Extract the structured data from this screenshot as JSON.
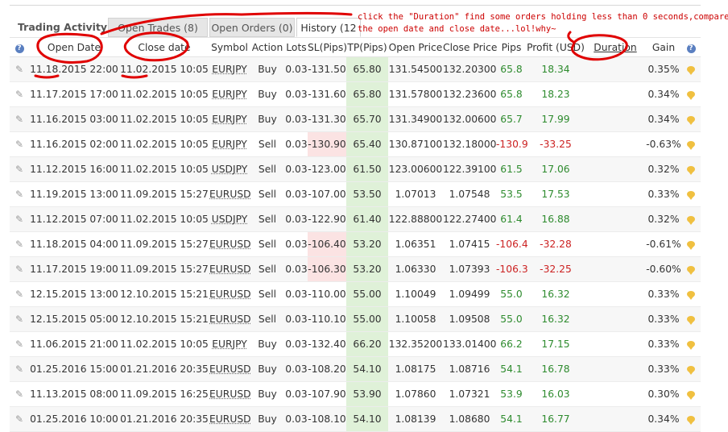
{
  "tabs": {
    "title": "Trading Activity",
    "open_trades": "Open Trades (8)",
    "open_orders": "Open Orders (0)",
    "history": "History (12"
  },
  "annotation": "click the \"Duration\" find some orders holding less than 0 seconds,compare\nthe open date and close date...lol!why~",
  "headers": [
    "Open Date",
    "Close date",
    "Symbol",
    "Action",
    "Lots",
    "SL(Pips)",
    "TP(Pips)",
    "Open Price",
    "Close Price",
    "Pips",
    "Profit (USD)",
    "Duration",
    "Gain"
  ],
  "colors": {
    "positive": "#2e8b2e",
    "negative": "#cc2222",
    "tp_fill": "#dff1d8",
    "sl_fill": "#fbe3e3",
    "annotation": "#cc0000"
  },
  "rows": [
    {
      "open": "11.18.2015 22:00",
      "close": "11.02.2015 10:05",
      "symbol": "EURJPY",
      "action": "Buy",
      "lots": "0.03",
      "sl": "-131.50",
      "tp": "65.80",
      "open_price": "131.54500",
      "close_price": "132.20300",
      "pips": "65.8",
      "profit": "18.34",
      "gain": "0.35%",
      "neg": false,
      "sl_bad": false
    },
    {
      "open": "11.17.2015 17:00",
      "close": "11.02.2015 10:05",
      "symbol": "EURJPY",
      "action": "Buy",
      "lots": "0.03",
      "sl": "-131.60",
      "tp": "65.80",
      "open_price": "131.57800",
      "close_price": "132.23600",
      "pips": "65.8",
      "profit": "18.23",
      "gain": "0.34%",
      "neg": false,
      "sl_bad": false
    },
    {
      "open": "11.16.2015 03:00",
      "close": "11.02.2015 10:05",
      "symbol": "EURJPY",
      "action": "Buy",
      "lots": "0.03",
      "sl": "-131.30",
      "tp": "65.70",
      "open_price": "131.34900",
      "close_price": "132.00600",
      "pips": "65.7",
      "profit": "17.99",
      "gain": "0.34%",
      "neg": false,
      "sl_bad": false
    },
    {
      "open": "11.16.2015 02:00",
      "close": "11.02.2015 10:05",
      "symbol": "EURJPY",
      "action": "Sell",
      "lots": "0.03",
      "sl": "-130.90",
      "tp": "65.40",
      "open_price": "130.87100",
      "close_price": "132.18000",
      "pips": "-130.9",
      "profit": "-33.25",
      "gain": "-0.63%",
      "neg": true,
      "sl_bad": true
    },
    {
      "open": "11.12.2015 16:00",
      "close": "11.02.2015 10:05",
      "symbol": "USDJPY",
      "action": "Sell",
      "lots": "0.03",
      "sl": "-123.00",
      "tp": "61.50",
      "open_price": "123.00600",
      "close_price": "122.39100",
      "pips": "61.5",
      "profit": "17.06",
      "gain": "0.32%",
      "neg": false,
      "sl_bad": false
    },
    {
      "open": "11.19.2015 13:00",
      "close": "11.09.2015 15:27",
      "symbol": "EURUSD",
      "action": "Sell",
      "lots": "0.03",
      "sl": "-107.00",
      "tp": "53.50",
      "open_price": "1.07013",
      "close_price": "1.07548",
      "pips": "53.5",
      "profit": "17.53",
      "gain": "0.33%",
      "neg": false,
      "sl_bad": false
    },
    {
      "open": "11.12.2015 07:00",
      "close": "11.02.2015 10:05",
      "symbol": "USDJPY",
      "action": "Sell",
      "lots": "0.03",
      "sl": "-122.90",
      "tp": "61.40",
      "open_price": "122.88800",
      "close_price": "122.27400",
      "pips": "61.4",
      "profit": "16.88",
      "gain": "0.32%",
      "neg": false,
      "sl_bad": false
    },
    {
      "open": "11.18.2015 04:00",
      "close": "11.09.2015 15:27",
      "symbol": "EURUSD",
      "action": "Sell",
      "lots": "0.03",
      "sl": "-106.40",
      "tp": "53.20",
      "open_price": "1.06351",
      "close_price": "1.07415",
      "pips": "-106.4",
      "profit": "-32.28",
      "gain": "-0.61%",
      "neg": true,
      "sl_bad": true
    },
    {
      "open": "11.17.2015 19:00",
      "close": "11.09.2015 15:27",
      "symbol": "EURUSD",
      "action": "Sell",
      "lots": "0.03",
      "sl": "-106.30",
      "tp": "53.20",
      "open_price": "1.06330",
      "close_price": "1.07393",
      "pips": "-106.3",
      "profit": "-32.25",
      "gain": "-0.60%",
      "neg": true,
      "sl_bad": true
    },
    {
      "open": "12.15.2015 13:00",
      "close": "12.10.2015 15:21",
      "symbol": "EURUSD",
      "action": "Sell",
      "lots": "0.03",
      "sl": "-110.00",
      "tp": "55.00",
      "open_price": "1.10049",
      "close_price": "1.09499",
      "pips": "55.0",
      "profit": "16.32",
      "gain": "0.33%",
      "neg": false,
      "sl_bad": false
    },
    {
      "open": "12.15.2015 05:00",
      "close": "12.10.2015 15:21",
      "symbol": "EURUSD",
      "action": "Sell",
      "lots": "0.03",
      "sl": "-110.10",
      "tp": "55.00",
      "open_price": "1.10058",
      "close_price": "1.09508",
      "pips": "55.0",
      "profit": "16.32",
      "gain": "0.33%",
      "neg": false,
      "sl_bad": false
    },
    {
      "open": "11.06.2015 21:00",
      "close": "11.02.2015 10:05",
      "symbol": "EURJPY",
      "action": "Buy",
      "lots": "0.03",
      "sl": "-132.40",
      "tp": "66.20",
      "open_price": "132.35200",
      "close_price": "133.01400",
      "pips": "66.2",
      "profit": "17.15",
      "gain": "0.33%",
      "neg": false,
      "sl_bad": false
    },
    {
      "open": "01.25.2016 15:00",
      "close": "01.21.2016 20:35",
      "symbol": "EURUSD",
      "action": "Buy",
      "lots": "0.03",
      "sl": "-108.20",
      "tp": "54.10",
      "open_price": "1.08175",
      "close_price": "1.08716",
      "pips": "54.1",
      "profit": "16.78",
      "gain": "0.33%",
      "neg": false,
      "sl_bad": false
    },
    {
      "open": "11.13.2015 08:00",
      "close": "11.09.2015 16:25",
      "symbol": "EURUSD",
      "action": "Buy",
      "lots": "0.03",
      "sl": "-107.90",
      "tp": "53.90",
      "open_price": "1.07860",
      "close_price": "1.07321",
      "pips": "53.9",
      "profit": "16.03",
      "gain": "0.30%",
      "neg": false,
      "sl_bad": false
    },
    {
      "open": "01.25.2016 10:00",
      "close": "01.21.2016 20:35",
      "symbol": "EURUSD",
      "action": "Buy",
      "lots": "0.03",
      "sl": "-108.10",
      "tp": "54.10",
      "open_price": "1.08139",
      "close_price": "1.08680",
      "pips": "54.1",
      "profit": "16.77",
      "gain": "0.34%",
      "neg": false,
      "sl_bad": false
    }
  ]
}
